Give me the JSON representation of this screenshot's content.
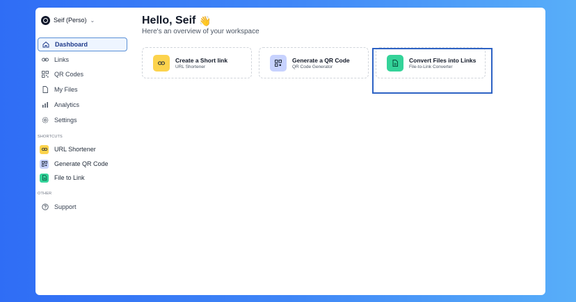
{
  "workspace": {
    "name": "Seif (Perso)"
  },
  "nav": {
    "items": [
      {
        "label": "Dashboard",
        "icon": "home-icon",
        "active": true
      },
      {
        "label": "Links",
        "icon": "link-icon"
      },
      {
        "label": "QR Codes",
        "icon": "qr-code-icon"
      },
      {
        "label": "My Files",
        "icon": "file-icon"
      },
      {
        "label": "Analytics",
        "icon": "bar-chart-icon"
      },
      {
        "label": "Settings",
        "icon": "gear-icon"
      }
    ]
  },
  "shortcuts": {
    "heading": "SHORTCUTS",
    "items": [
      {
        "label": "URL Shortener",
        "icon": "link-icon",
        "color": "#fcd34d"
      },
      {
        "label": "Generate QR Code",
        "icon": "qr-code-icon",
        "color": "#c7d2fe"
      },
      {
        "label": "File to Link",
        "icon": "file-icon",
        "color": "#34d399"
      }
    ]
  },
  "other": {
    "heading": "OTHER",
    "items": [
      {
        "label": "Support",
        "icon": "help-circle-icon"
      }
    ]
  },
  "header": {
    "greeting": "Hello, Seif",
    "emoji": "👋",
    "subtitle": "Here's an overview of your workspace"
  },
  "cards": [
    {
      "title": "Create a Short link",
      "subtitle": "URL Shortener",
      "icon": "link-icon",
      "color": "#fcd34d"
    },
    {
      "title": "Generate a QR Code",
      "subtitle": "QR Code Generator",
      "icon": "qr-code-icon",
      "color": "#c7d2fe"
    },
    {
      "title": "Convert Files into Links",
      "subtitle": "File-to-Link Converter",
      "icon": "file-icon",
      "color": "#34d399"
    }
  ],
  "colors": {
    "accent": "#2d62c4",
    "active_bg": "#eef5ff"
  }
}
